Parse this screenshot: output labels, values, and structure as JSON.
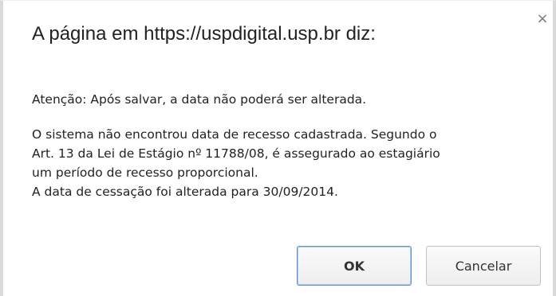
{
  "dialog": {
    "title": "A página em https://uspdigital.usp.br diz:",
    "close_icon": "×",
    "message": {
      "line1": "Atenção: Após salvar, a data não poderá ser alterada.",
      "paragraph2": "O sistema não encontrou data de recesso cadastrada. Segundo o\nArt. 13 da Lei de Estágio nº 11788/08, é assegurado ao estagiário\num período de recesso proporcional.\nA data de cessação foi alterada para 30/09/2014."
    },
    "buttons": {
      "ok_label": "OK",
      "cancel_label": "Cancelar"
    }
  },
  "colors": {
    "ok_border": "#5b93d9",
    "text": "#222222"
  }
}
